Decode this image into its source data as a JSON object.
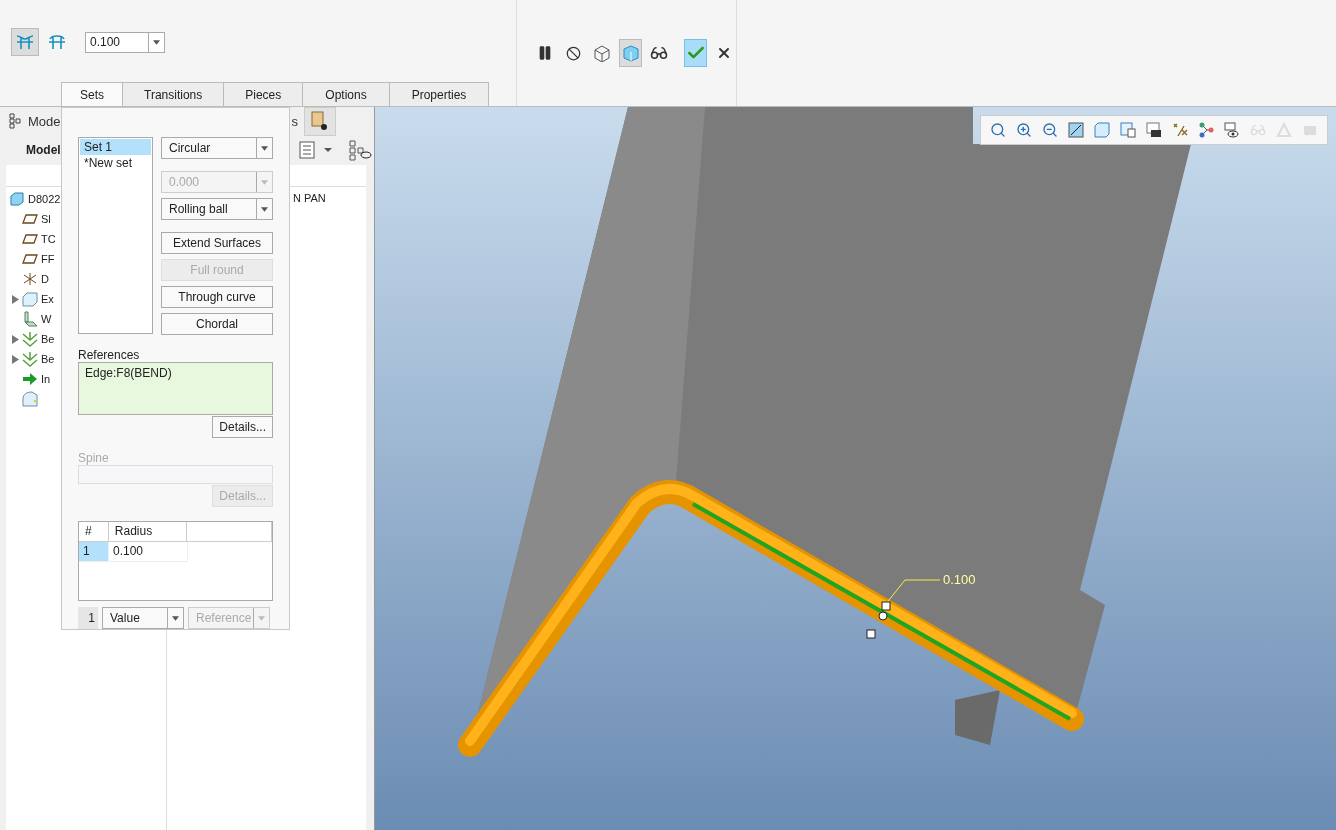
{
  "ribbon": {
    "shape_buttons": [
      {
        "selected": true
      },
      {
        "selected": false
      }
    ],
    "value": "0.100",
    "tabs": [
      {
        "label": "Sets",
        "selected": true
      },
      {
        "label": "Transitions",
        "selected": false
      },
      {
        "label": "Pieces",
        "selected": false
      },
      {
        "label": "Options",
        "selected": false
      },
      {
        "label": "Properties",
        "selected": false
      }
    ],
    "actions": [
      {
        "kind": "pause",
        "selected": false
      },
      {
        "kind": "stop",
        "selected": false
      },
      {
        "kind": "wireframe",
        "selected": false
      },
      {
        "kind": "shaded",
        "selected": true
      },
      {
        "kind": "glasses",
        "selected": false
      },
      {
        "kind": "confirm",
        "selected": true
      },
      {
        "kind": "cancel",
        "selected": false
      }
    ]
  },
  "model_tree": {
    "tabs": [
      "Mode",
      "s"
    ],
    "title": "Model",
    "column_2_cell": "N PAN",
    "items": [
      {
        "label": "D8022",
        "kind": "part",
        "expandable": false,
        "children": [
          {
            "label": "Sl",
            "kind": "plane",
            "expandable": false
          },
          {
            "label": "TC",
            "kind": "plane",
            "expandable": false
          },
          {
            "label": "FF",
            "kind": "plane",
            "expandable": false
          },
          {
            "label": "D",
            "kind": "csys",
            "expandable": false
          },
          {
            "label": "Ex",
            "kind": "extrude",
            "expandable": true
          },
          {
            "label": "W",
            "kind": "wall",
            "expandable": false
          },
          {
            "label": "Be",
            "kind": "bend",
            "expandable": true
          },
          {
            "label": "Be",
            "kind": "bend",
            "expandable": true
          },
          {
            "label": "In",
            "kind": "insert",
            "expandable": false
          },
          {
            "kind": "round",
            "expandable": false
          }
        ]
      }
    ]
  },
  "sets_panel": {
    "sets": [
      {
        "label": "Set 1",
        "selected": true
      },
      {
        "label": "*New set",
        "selected": false
      }
    ],
    "shape": {
      "value": "Circular",
      "disabled": false
    },
    "distance": {
      "value": "0.000",
      "disabled": true
    },
    "method": {
      "value": "Rolling ball",
      "disabled": false
    },
    "buttons": [
      {
        "label": "Extend Surfaces",
        "disabled": false
      },
      {
        "label": "Full round",
        "disabled": true
      },
      {
        "label": "Through curve",
        "disabled": false
      },
      {
        "label": "Chordal",
        "disabled": false
      }
    ],
    "references": {
      "label": "References",
      "items": [
        "Edge:F8(BEND)"
      ],
      "details": {
        "label": "Details...",
        "disabled": false
      }
    },
    "spine": {
      "label": "Spine",
      "disabled": true,
      "details": {
        "label": "Details...",
        "disabled": true
      }
    },
    "table": {
      "columns": [
        "#",
        "Radius"
      ],
      "rows": [
        {
          "cells": [
            "1",
            "0.100"
          ],
          "selected": true
        }
      ]
    },
    "footer": {
      "count": "1",
      "type": {
        "value": "Value",
        "disabled": false
      },
      "reference": {
        "value": "Reference",
        "disabled": true
      }
    }
  },
  "viewport": {
    "dimension": "0.100",
    "tools": [
      {
        "kind": "zoom-fit",
        "disabled": false
      },
      {
        "kind": "zoom-in",
        "disabled": false
      },
      {
        "kind": "zoom-out",
        "disabled": false
      },
      {
        "kind": "repaint",
        "disabled": false
      },
      {
        "kind": "display",
        "disabled": false
      },
      {
        "kind": "views",
        "disabled": false
      },
      {
        "kind": "snapshot",
        "disabled": false
      },
      {
        "kind": "datum",
        "disabled": false
      },
      {
        "kind": "nodes",
        "disabled": false
      },
      {
        "kind": "visibility",
        "disabled": false
      },
      {
        "kind": "glasses",
        "disabled": true
      },
      {
        "kind": "triangle",
        "disabled": true
      },
      {
        "kind": "shape",
        "disabled": true
      }
    ]
  }
}
